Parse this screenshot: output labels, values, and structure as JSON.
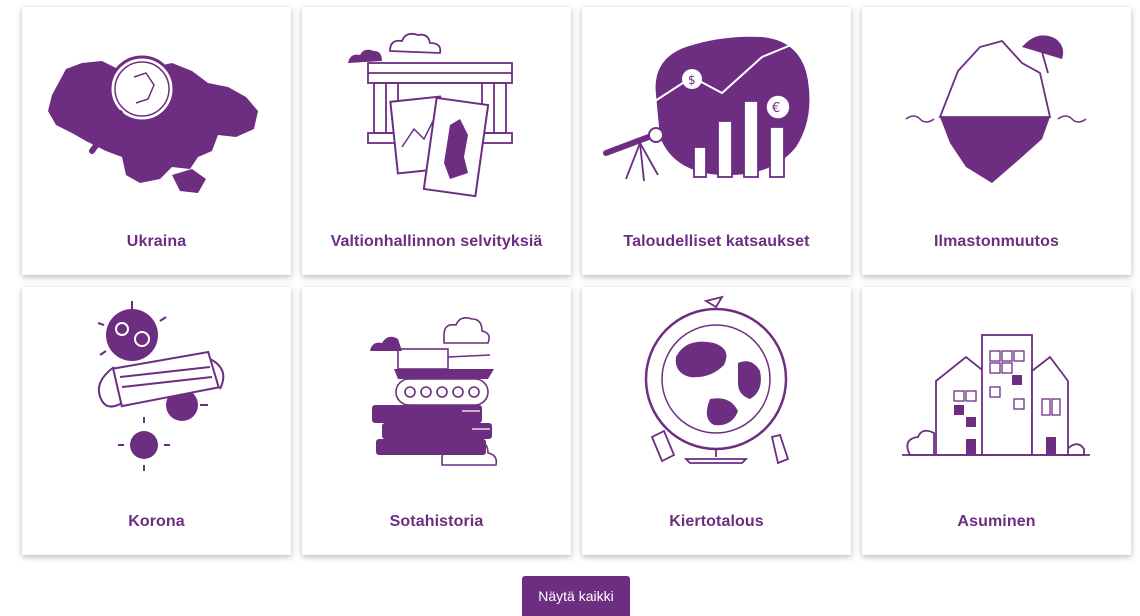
{
  "theme": {
    "accent": "#6d2e82"
  },
  "cards": [
    {
      "label": "Ukraina",
      "icon": "ukraine-map-magnifier-icon"
    },
    {
      "label": "Valtionhallinnon selvityksiä",
      "icon": "government-building-documents-icon"
    },
    {
      "label": "Taloudelliset katsaukset",
      "icon": "telescope-economy-chart-icon"
    },
    {
      "label": "Ilmastonmuutos",
      "icon": "iceberg-umbrella-icon"
    },
    {
      "label": "Korona",
      "icon": "virus-facemask-icon"
    },
    {
      "label": "Sotahistoria",
      "icon": "tank-books-icon"
    },
    {
      "label": "Kiertotalous",
      "icon": "globe-recycling-icon"
    },
    {
      "label": "Asuminen",
      "icon": "apartment-buildings-icon"
    }
  ],
  "show_all_button": {
    "label": "Näytä kaikki"
  }
}
